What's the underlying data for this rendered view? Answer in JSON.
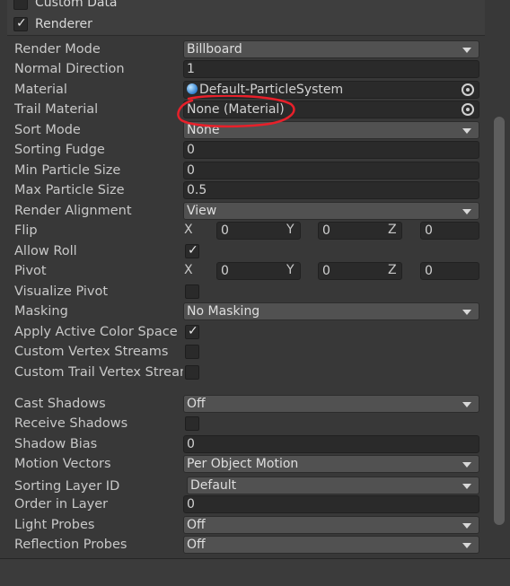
{
  "custom_data": {
    "title": "Custom Data",
    "checked": false
  },
  "renderer": {
    "title": "Renderer",
    "checked": true
  },
  "props": {
    "render_mode": {
      "label": "Render Mode",
      "value": "Billboard"
    },
    "normal_direction": {
      "label": "Normal Direction",
      "value": "1"
    },
    "material": {
      "label": "Material",
      "value": "Default-ParticleSystem",
      "icon": "material-sphere-icon"
    },
    "trail_material": {
      "label": "Trail Material",
      "value": "None (Material)"
    },
    "sort_mode": {
      "label": "Sort Mode",
      "value": "None"
    },
    "sorting_fudge": {
      "label": "Sorting Fudge",
      "value": "0"
    },
    "min_particle_size": {
      "label": "Min Particle Size",
      "value": "0"
    },
    "max_particle_size": {
      "label": "Max Particle Size",
      "value": "0.5"
    },
    "render_alignment": {
      "label": "Render Alignment",
      "value": "View"
    },
    "flip": {
      "label": "Flip",
      "x_label": "X",
      "x": "0",
      "y_label": "Y",
      "y": "0",
      "z_label": "Z",
      "z": "0"
    },
    "allow_roll": {
      "label": "Allow Roll",
      "checked": true
    },
    "pivot": {
      "label": "Pivot",
      "x_label": "X",
      "x": "0",
      "y_label": "Y",
      "y": "0",
      "z_label": "Z",
      "z": "0"
    },
    "visualize_pivot": {
      "label": "Visualize Pivot",
      "checked": false
    },
    "masking": {
      "label": "Masking",
      "value": "No Masking"
    },
    "apply_active_color_space": {
      "label": "Apply Active Color Space",
      "checked": true
    },
    "custom_vertex_streams": {
      "label": "Custom Vertex Streams",
      "checked": false
    },
    "custom_trail_vertex_streams": {
      "label": "Custom Trail Vertex Streams",
      "checked": false
    },
    "cast_shadows": {
      "label": "Cast Shadows",
      "value": "Off"
    },
    "receive_shadows": {
      "label": "Receive Shadows",
      "checked": false
    },
    "shadow_bias": {
      "label": "Shadow Bias",
      "value": "0"
    },
    "motion_vectors": {
      "label": "Motion Vectors",
      "value": "Per Object Motion"
    },
    "sorting_layer_id": {
      "label": "Sorting Layer ID",
      "value": "Default"
    },
    "order_in_layer": {
      "label": "Order in Layer",
      "value": "0"
    },
    "light_probes": {
      "label": "Light Probes",
      "value": "Off"
    },
    "reflection_probes": {
      "label": "Reflection Probes",
      "value": "Off"
    }
  },
  "colors": {
    "annotation": "#e8202a",
    "background": "#383838",
    "field": "#2a2a2a",
    "dropdown": "#515151"
  }
}
